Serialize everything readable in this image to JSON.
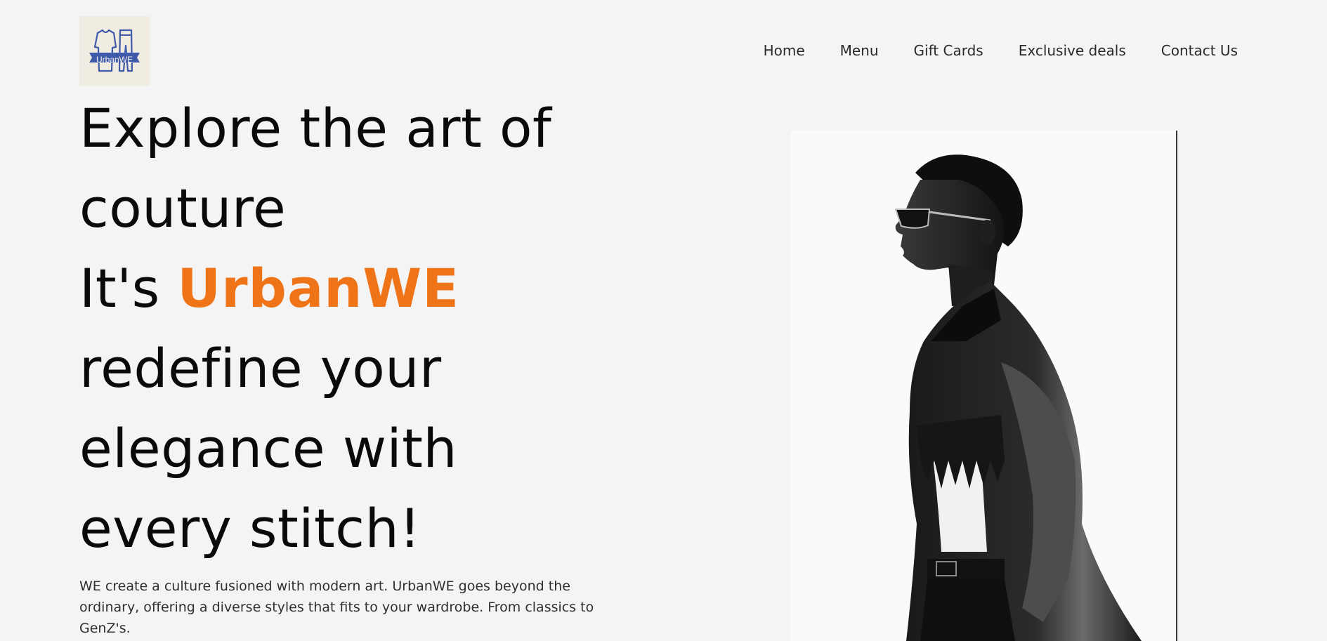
{
  "brand": {
    "logo_text": "UrbanWE",
    "logo_colors": {
      "bg": "#f1ece2",
      "ink": "#3f5aa8"
    }
  },
  "nav": {
    "items": [
      "Home",
      "Menu",
      "Gift Cards",
      "Exclusive deals",
      "Contact Us"
    ]
  },
  "hero": {
    "line1": "Explore the art of",
    "line2": "couture",
    "line3_prefix": "It's ",
    "line3_brand": "UrbanWE",
    "line4": "redefine your",
    "line5": "elegance with",
    "line6": "every stitch!",
    "description": "WE create a culture fusioned with modern art. UrbanWE goes beyond the ordinary, offering a diverse styles that fits to your wardrobe. From classics to GenZ's.",
    "accent_color": "#ef7317"
  },
  "image": {
    "icon": "model-photo",
    "style": "black-and-white"
  }
}
